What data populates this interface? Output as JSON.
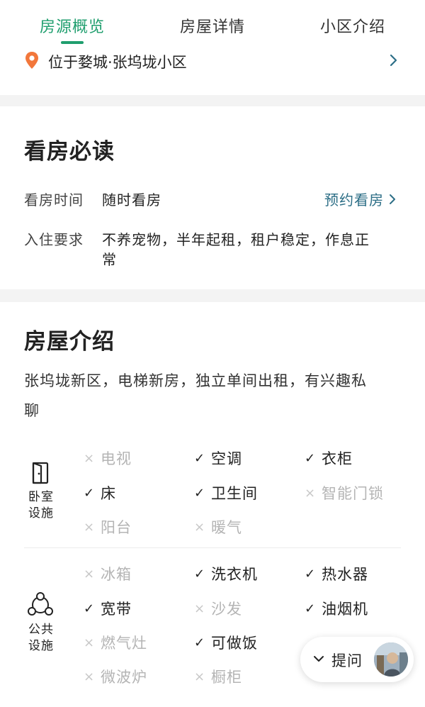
{
  "tabs": [
    {
      "label": "房源概览",
      "active": true
    },
    {
      "label": "房屋详情",
      "active": false
    },
    {
      "label": "小区介绍",
      "active": false
    }
  ],
  "location": {
    "text": "位于婺城·张坞垅小区",
    "icon": "location-pin-icon"
  },
  "viewing": {
    "title": "看房必读",
    "time_label": "看房时间",
    "time_value": "随时看房",
    "book_link": "预约看房",
    "req_label": "入住要求",
    "req_value_line1": "不养宠物，半年起租，租户稳定，作息正",
    "req_value_line2": "常"
  },
  "intro": {
    "title": "房屋介绍",
    "desc_line1": "张坞垅新区，电梯新房，独立单间出租，有兴趣私",
    "desc_line2": "聊"
  },
  "bedroom": {
    "label_line1": "卧室",
    "label_line2": "设施",
    "icon": "door-icon",
    "items": [
      {
        "name": "电视",
        "available": false
      },
      {
        "name": "空调",
        "available": true
      },
      {
        "name": "衣柜",
        "available": true
      },
      {
        "name": "床",
        "available": true
      },
      {
        "name": "卫生间",
        "available": true
      },
      {
        "name": "智能门锁",
        "available": false
      },
      {
        "name": "阳台",
        "available": false
      },
      {
        "name": "暖气",
        "available": false
      }
    ]
  },
  "public": {
    "label_line1": "公共",
    "label_line2": "设施",
    "icon": "community-icon",
    "items": [
      {
        "name": "冰箱",
        "available": false
      },
      {
        "name": "洗衣机",
        "available": true
      },
      {
        "name": "热水器",
        "available": true
      },
      {
        "name": "宽带",
        "available": true
      },
      {
        "name": "沙发",
        "available": false
      },
      {
        "name": "油烟机",
        "available": true
      },
      {
        "name": "燃气灶",
        "available": false
      },
      {
        "name": "可做饭",
        "available": true
      },
      {
        "name": "微波炉",
        "available": false
      },
      {
        "name": "橱柜",
        "available": false
      }
    ]
  },
  "ask": {
    "label": "提问"
  },
  "marks": {
    "on": "✓",
    "off": "×"
  },
  "colors": {
    "accent": "#1f9e6e",
    "link": "#2c6e86",
    "pin": "#f2773b",
    "unavailable": "#b4b4b4"
  }
}
